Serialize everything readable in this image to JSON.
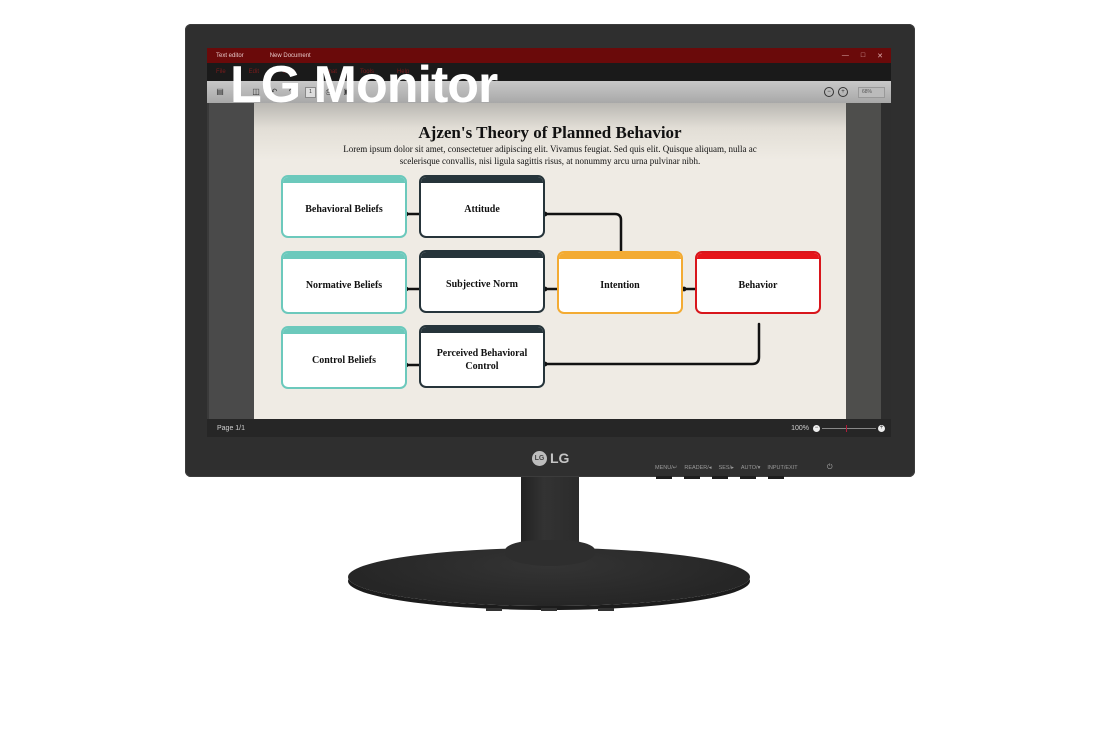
{
  "overlay": {
    "brand_text": "LG Monitor"
  },
  "window": {
    "app_title": "Text editor",
    "document_tab": "New Document",
    "controls": {
      "minimize": "—",
      "maximize": "□",
      "close": "✕"
    }
  },
  "menubar": {
    "items": [
      "File",
      "Edit",
      "View",
      "Format",
      "Tools",
      "Help"
    ]
  },
  "toolbar": {
    "icons": [
      "save-icon",
      "back-icon",
      "image-icon",
      "undo-icon",
      "redo-icon",
      "print-icon",
      "export-icon"
    ],
    "page_field": "1",
    "zoom_select": "68%",
    "zoom_out": "−",
    "zoom_in": "+"
  },
  "document": {
    "title": "Ajzen's Theory of Planned Behavior",
    "body": "Lorem ipsum dolor sit amet, consectetuer adipiscing elit. Vivamus feugiat. Sed quis elit. Quisque aliquam, nulla ac scelerisque convallis, nisi ligula sagittis risus, at nonummy arcu urna pulvinar nibh.",
    "diagram": {
      "nodes": {
        "behavioral_beliefs": "Behavioral Beliefs",
        "attitude": "Attitude",
        "normative_beliefs": "Normative Beliefs",
        "subjective_norm": "Subjective Norm",
        "control_beliefs": "Control Beliefs",
        "perceived_control": "Perceived Behavioral Control",
        "intention": "Intention",
        "behavior": "Behavior"
      },
      "colors": {
        "beliefs": "#6cc9bc",
        "constructs": "#26343a",
        "intention": "#f3ab33",
        "behavior": "#e61419"
      }
    }
  },
  "statusbar": {
    "page": "Page  1/1",
    "zoom": "100%",
    "zoom_level_fraction": 0.45
  },
  "bezel": {
    "logo": "LG",
    "logo_mark": "LG",
    "buttons": [
      "MENU/↵",
      "READER/◂",
      "SES/▸",
      "AUTO/▾",
      "INPUT/EXIT"
    ],
    "power": "⏻"
  }
}
